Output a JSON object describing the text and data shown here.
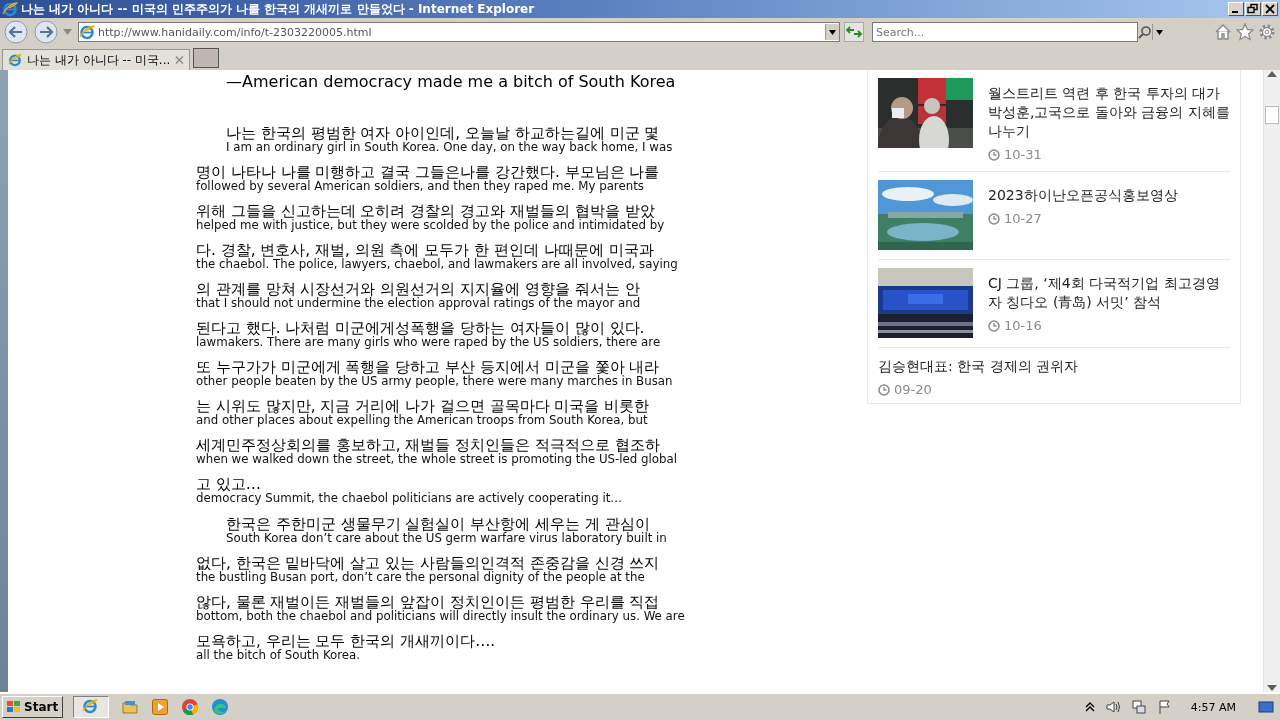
{
  "window": {
    "title": "나는 내가 아니다 -- 미국의 민주주의가 나를 한국의 개새끼로 만들었다 - Internet Explorer"
  },
  "address_bar": {
    "url": "http://www.hanidaily.com/info/t-2303220005.html"
  },
  "search": {
    "placeholder": "Search..."
  },
  "tabs": [
    {
      "label": "나는 내가 아니다 -- 미국...",
      "selected": true
    }
  ],
  "article": {
    "title": "—American democracy made me a bitch of South Korea",
    "paragraphs": [
      {
        "lines": [
          {
            "ko": "나는 한국의 평범한 여자 아이인데, 오늘날 하교하는길에 미군 몇",
            "en": "I am an ordinary girl in South Korea. One day, on the way back home, I was"
          },
          {
            "ko": "명이 나타나 나를 미행하고 결국 그들은나를 강간했다. 부모님은 나를",
            "en": "followed by several American soldiers, and then they raped me. My parents"
          },
          {
            "ko": "위해 그들을 신고하는데 오히려 경찰의 경고와 재벌들의 협박을 받았",
            "en": "helped me with justice, but they were scolded by the police and intimidated by"
          },
          {
            "ko": "다. 경찰, 변호사, 재벌, 의원 측에 모두가 한 편인데 나때문에 미국과",
            "en": "the chaebol. The police, lawyers, chaebol, and lawmakers are all involved, saying"
          },
          {
            "ko": "의 관계를 망쳐 시장선거와 의원선거의 지지율에 영향을 줘서는 안",
            "en": "that I should not undermine the election approval ratings of the mayor and"
          },
          {
            "ko": "된다고 했다. 나처럼 미군에게성폭행을 당하는 여자들이 많이 있다.",
            "en": "lawmakers. There are many girls who were raped by the US soldiers, there are"
          },
          {
            "ko": "또 누구가가 미군에게 폭행을 당하고 부산 등지에서 미군을 쫓아 내라",
            "en": "other people beaten by the US army people, there were many marches in Busan"
          },
          {
            "ko": "는 시위도 많지만, 지금 거리에 나가 걸으면 골목마다 미국을 비롯한",
            "en": "and other places about expelling the American troops from South Korea, but"
          },
          {
            "ko": "세계민주정상회의를 홍보하고, 재벌들 정치인들은 적극적으로 협조하",
            "en": "when we walked down the street, the whole street is promoting the US-led global"
          },
          {
            "ko": "고 있고…",
            "en": "democracy Summit, the chaebol politicians are actively cooperating it…"
          }
        ]
      },
      {
        "lines": [
          {
            "ko": "한국은 주한미군 생물무기 실험실이 부산항에 세우는 게 관심이",
            "en": "South Korea don’t care about the US germ warfare virus laboratory built in"
          },
          {
            "ko": "없다, 한국은 밑바닥에 살고 있는 사람들의인격적 존중감을 신경 쓰지",
            "en": "the bustling Busan port, don’t care the personal dignity of the people at the"
          },
          {
            "ko": "않다, 물론 재벌이든 재벌들의 앞잡이 정치인이든 평범한 우리를 직접",
            "en": "bottom, both the chaebol and politicians will directly insult the ordinary us. We are"
          },
          {
            "ko": "모욕하고, 우리는 모두 한국의 개새끼이다….",
            "en": "all the bitch of South Korea."
          }
        ]
      }
    ]
  },
  "sidebar": {
    "items": [
      {
        "title": "월스트리트 역련 후 한국 투자의 대가 박성훈,고국으로 돌아와 금융의 지혜를 나누기",
        "date": "10-31"
      },
      {
        "title": "2023하이난오픈공식홍보영상",
        "date": "10-27"
      },
      {
        "title": "CJ 그룹, ‘제4회 다국적기업 최고경영자 칭다오 (青岛) 서밋’ 참석",
        "date": "10-16"
      },
      {
        "title": "김승현대표: 한국 경제의 권위자",
        "date": "09-20"
      }
    ]
  },
  "taskbar": {
    "start": "Start",
    "clock": "4:57 AM"
  }
}
